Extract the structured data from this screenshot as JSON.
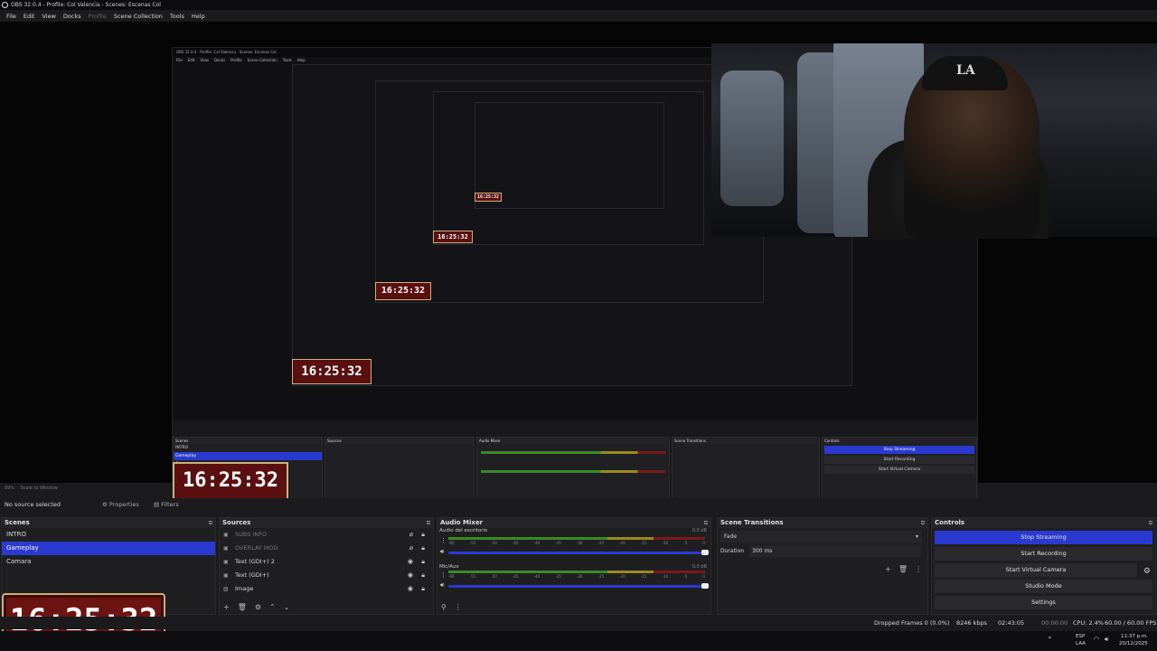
{
  "window": {
    "title": "OBS 32.0.4 - Profile: Col Valencia - Scenes: Escenas Col"
  },
  "menu": [
    "File",
    "Edit",
    "View",
    "Docks",
    "Profile",
    "Scene Collection",
    "Tools",
    "Help"
  ],
  "preview": {
    "zoom": "99%",
    "scale_mode": "Scale to Window",
    "nested_clock_texts": [
      "16:25:32",
      "16:25:32",
      "16:25:32",
      "16:25:32",
      "16:25:32"
    ]
  },
  "source_bar": {
    "status": "No source selected",
    "properties": "Properties",
    "filters": "Filters"
  },
  "scenes": {
    "title": "Scenes",
    "items": [
      "INTRO",
      "Gameplay",
      "Camara"
    ],
    "selected": "Gameplay"
  },
  "sources": {
    "title": "Sources",
    "items": [
      {
        "name": "SUBS INFO",
        "visible": false
      },
      {
        "name": "OVERLAY MOD",
        "visible": false
      },
      {
        "name": "Text (GDI+) 2",
        "visible": true
      },
      {
        "name": "Text (GDI+)",
        "visible": true
      },
      {
        "name": "Image",
        "visible": true
      }
    ]
  },
  "audio_mixer": {
    "title": "Audio Mixer",
    "channels": [
      {
        "name": "Audio del escritorio",
        "db": "0.0 dB"
      },
      {
        "name": "Mic/Aux",
        "db": "0.0 dB"
      }
    ],
    "scale": [
      "-60",
      "-55",
      "-50",
      "-45",
      "-40",
      "-35",
      "-30",
      "-25",
      "-20",
      "-15",
      "-10",
      "-5",
      "0"
    ]
  },
  "scene_transitions": {
    "title": "Scene Transitions",
    "transition": "Fade",
    "duration_label": "Duration",
    "duration_value": "300 ms"
  },
  "controls": {
    "title": "Controls",
    "buttons": [
      "Stop Streaming",
      "Start Recording",
      "Start Virtual Camera",
      "Studio Mode",
      "Settings"
    ]
  },
  "clock_overlay": {
    "text": "16:25:32"
  },
  "camera": {
    "cap_letters": "LA"
  },
  "status": {
    "dropped_frames": "Dropped Frames 0 (0.0%)",
    "bitrate": "8246 kbps",
    "stream_time": "02:43:05",
    "record_time": "00:00:00",
    "cpu": "CPU: 2.4%",
    "fps": "60.00 / 60.00 FPS"
  },
  "taskbar": {
    "lang_top": "ESP",
    "lang_bottom": "LAA",
    "time": "11:37 p.m.",
    "date": "20/12/2025"
  },
  "colors": {
    "accent": "#2a3ad0",
    "panel": "#1f1f22",
    "clock_bg": "#6b1412"
  }
}
